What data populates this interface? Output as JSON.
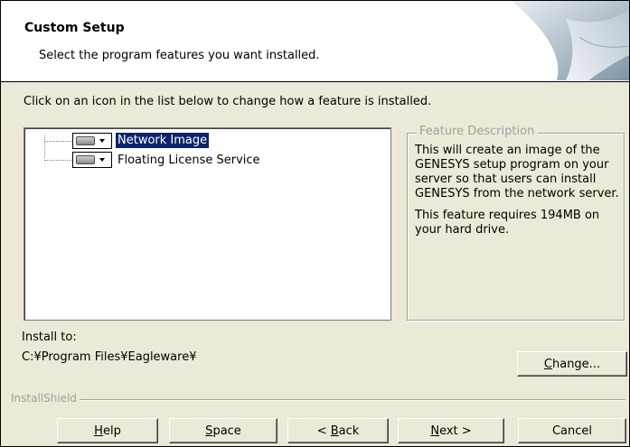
{
  "header": {
    "title": "Custom Setup",
    "subtitle": "Select the program features you want installed."
  },
  "instruction": "Click on an icon in the list below to change how a feature is installed.",
  "tree": {
    "items": [
      {
        "label": "Network Image",
        "icon": "hard-drive-icon",
        "selected": true
      },
      {
        "label": "Floating License Service",
        "icon": "hard-drive-icon",
        "selected": false
      }
    ]
  },
  "feature_description": {
    "legend": "Feature Description",
    "paragraph1": "This will create an image of the GENESYS setup program on your server so that users can install GENESYS from the network server.",
    "paragraph2": "This feature requires 194MB on your hard drive."
  },
  "install": {
    "label": "Install to:",
    "path": "C:¥Program Files¥Eagleware¥"
  },
  "buttons": {
    "change": {
      "pre": "",
      "accel": "C",
      "post": "hange..."
    },
    "help": {
      "pre": "",
      "accel": "H",
      "post": "elp"
    },
    "space": {
      "pre": "",
      "accel": "S",
      "post": "pace"
    },
    "back": {
      "pre": "< ",
      "accel": "B",
      "post": "ack"
    },
    "next": {
      "pre": "",
      "accel": "N",
      "post": "ext >"
    },
    "cancel": {
      "pre": "",
      "accel": "",
      "post": "Cancel"
    }
  },
  "footer": {
    "brand": "InstallShield"
  }
}
